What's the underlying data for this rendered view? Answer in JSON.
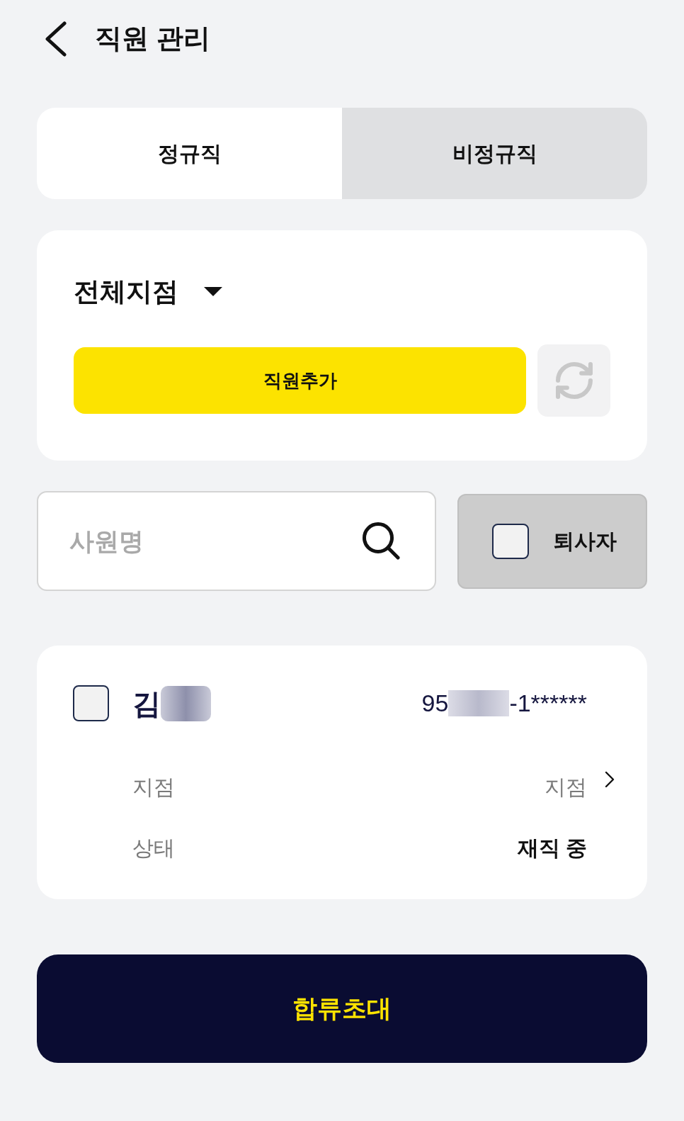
{
  "header": {
    "title": "직원 관리"
  },
  "tabs": [
    {
      "label": "정규직",
      "selected": true
    },
    {
      "label": "비정규직",
      "selected": false
    }
  ],
  "branch_filter": {
    "value": "전체지점"
  },
  "add_employee_button": {
    "label": "직원추가"
  },
  "search": {
    "placeholder": "사원명"
  },
  "retired_filter": {
    "label": "퇴사자",
    "checked": false
  },
  "employees": [
    {
      "checked": false,
      "name": "김",
      "name_blurred": true,
      "id_number_start": "95",
      "id_number_blurred": true,
      "id_number_end": "-1******",
      "fields": [
        {
          "kind": "plain",
          "label": "지점",
          "value": "지점"
        },
        {
          "kind": "bold",
          "label": "상태",
          "value": "재직 중"
        }
      ]
    }
  ],
  "invite_button": {
    "label": "합류초대"
  }
}
